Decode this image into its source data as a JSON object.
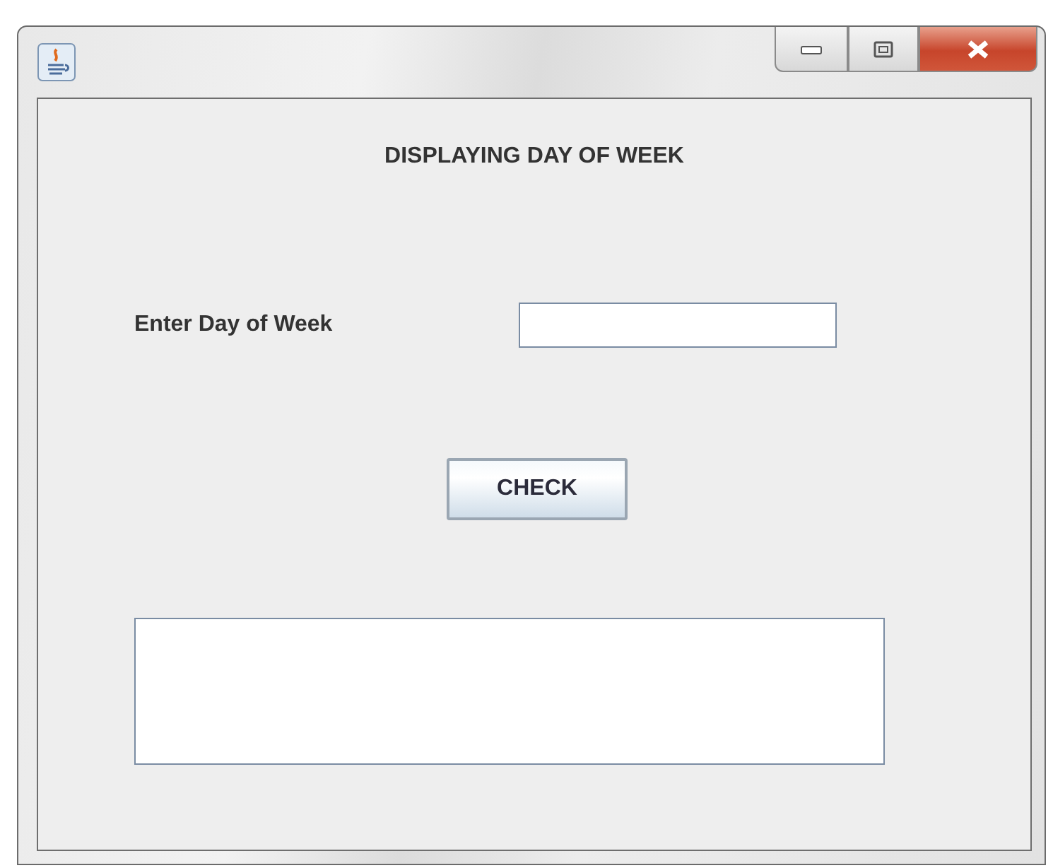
{
  "heading": "DISPLAYING DAY OF WEEK",
  "day_field": {
    "label": "Enter Day of Week"
  },
  "check_button": {
    "label": "CHECK"
  }
}
